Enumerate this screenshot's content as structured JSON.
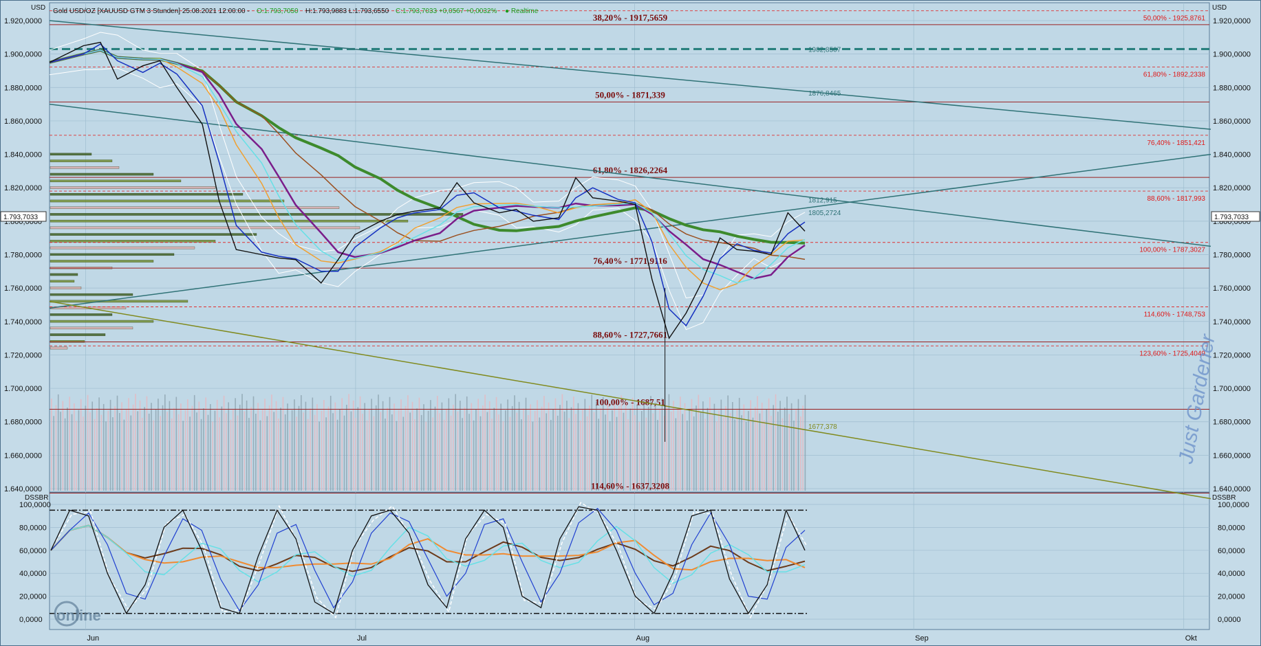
{
  "header": {
    "instrument": "Gold USD/OZ [XAUUSD GTM 3 Stunden] 25.08.2021 12:00:00 -",
    "open": "O:1.793,7050",
    "hl": "H:1.793,9883 L:1.793,6550",
    "close_change": "C:1.793,7033 +0,0567 +0,0032%",
    "realtime": "● Realtime"
  },
  "units": {
    "left": "USD",
    "right": "USD",
    "osc_left": "DSSBR",
    "osc_right": "DSSBR"
  },
  "current_price_label": "1.793,7033",
  "watermark": "Just Gardener",
  "logo_text": "online",
  "colors": {
    "background": "#c5dbe8",
    "fib_dashed": "#e03030",
    "fib_solid": "#9a2020",
    "teal_line": "#2f7276",
    "olive_line": "#808a1e",
    "green_ma": "#3d8a2c",
    "purple_ma": "#7a1d8a",
    "brown_ma": "#9a5020",
    "orange_ma": "#f0a030",
    "cyan_ma": "#66e0e6",
    "blue_ma": "#1530c0",
    "price": "#111111"
  },
  "chart_data": [
    {
      "type": "line",
      "title": "",
      "xlabel": "",
      "ylabel": "USD",
      "ylim": [
        1630,
        1930
      ],
      "grid": true,
      "x_ticks": [
        "Jun",
        "Jul",
        "Aug",
        "Sep",
        "Okt"
      ],
      "y_ticks": [
        "1.640,0000",
        "1.660,0000",
        "1.680,0000",
        "1.700,0000",
        "1.720,0000",
        "1.740,0000",
        "1.760,0000",
        "1.780,0000",
        "1.800,0000",
        "1.820,0000",
        "1.840,0000",
        "1.860,0000",
        "1.880,0000",
        "1.900,0000",
        "1.920,0000"
      ],
      "y_tick_values": [
        1640,
        1660,
        1680,
        1700,
        1720,
        1740,
        1760,
        1780,
        1800,
        1820,
        1840,
        1860,
        1880,
        1900,
        1920
      ],
      "price_series": {
        "x": [
          "2021-05-28",
          "2021-06-01",
          "2021-06-03",
          "2021-06-05",
          "2021-06-08",
          "2021-06-10",
          "2021-06-12",
          "2021-06-15",
          "2021-06-17",
          "2021-06-19",
          "2021-06-22",
          "2021-06-24",
          "2021-06-26",
          "2021-06-29",
          "2021-07-01",
          "2021-07-03",
          "2021-07-06",
          "2021-07-08",
          "2021-07-10",
          "2021-07-13",
          "2021-07-15",
          "2021-07-17",
          "2021-07-20",
          "2021-07-22",
          "2021-07-24",
          "2021-07-27",
          "2021-07-29",
          "2021-07-31",
          "2021-08-03",
          "2021-08-05",
          "2021-08-07",
          "2021-08-09",
          "2021-08-11",
          "2021-08-13",
          "2021-08-15",
          "2021-08-17",
          "2021-08-19",
          "2021-08-21",
          "2021-08-23",
          "2021-08-25"
        ],
        "y": [
          1895,
          1905,
          1907,
          1885,
          1893,
          1896,
          1880,
          1858,
          1812,
          1783,
          1780,
          1778,
          1777,
          1763,
          1777,
          1792,
          1800,
          1804,
          1806,
          1808,
          1823,
          1811,
          1805,
          1807,
          1800,
          1802,
          1826,
          1814,
          1812,
          1810,
          1765,
          1730,
          1745,
          1765,
          1790,
          1783,
          1782,
          1780,
          1805,
          1794
        ]
      },
      "fib_levels_right": [
        {
          "label": "50,00% - 1925,8761",
          "value": 1925.8761
        },
        {
          "label": "61,80% - 1892,2338",
          "value": 1892.2338
        },
        {
          "label": "76,40% - 1851,421",
          "value": 1851.421
        },
        {
          "label": "88,60% - 1817,993",
          "value": 1817.993
        },
        {
          "label": "100,00% - 1787,3027",
          "value": 1787.3027
        },
        {
          "label": "114,60% - 1748,753",
          "value": 1748.753
        },
        {
          "label": "123,60% - 1725,4049",
          "value": 1725.4049
        }
      ],
      "fib_levels_center": [
        {
          "label": "38,20% - 1917,5659",
          "value": 1917.5659
        },
        {
          "label": "50,00% - 1871,339",
          "value": 1871.339
        },
        {
          "label": "61,80% - 1826,2264",
          "value": 1826.2264
        },
        {
          "label": "76,40% - 1771,9116",
          "value": 1771.9116
        },
        {
          "label": "88,60% - 1727,7661",
          "value": 1727.7661
        },
        {
          "label": "100,00% - 1687,51",
          "value": 1687.51
        },
        {
          "label": "114,60% - 1637,3208",
          "value": 1637.3208
        }
      ],
      "teal_dashed_level": 1903,
      "trend_labels": [
        {
          "label": "1902,8507",
          "value": 1902.8507
        },
        {
          "label": "1876,8465",
          "value": 1876.8465
        },
        {
          "label": "1812,915",
          "value": 1812.915
        },
        {
          "label": "1805,2724",
          "value": 1805.2724
        },
        {
          "label": "1677,378",
          "value": 1677.378
        }
      ],
      "trendlines": [
        {
          "name": "teal-upper",
          "from": [
            "2021-05-28",
            1920
          ],
          "to": [
            "2021-10-04",
            1855
          ]
        },
        {
          "name": "teal-middle",
          "from": [
            "2021-05-28",
            1870
          ],
          "to": [
            "2021-10-04",
            1785
          ]
        },
        {
          "name": "teal-rising",
          "from": [
            "2021-05-28",
            1748
          ],
          "to": [
            "2021-10-04",
            1840
          ]
        },
        {
          "name": "olive-falling",
          "from": [
            "2021-05-28",
            1752
          ],
          "to": [
            "2021-10-04",
            1634
          ]
        }
      ]
    },
    {
      "type": "line",
      "title": "",
      "ylabel": "DSSBR",
      "ylim": [
        -5,
        105
      ],
      "y_ticks": [
        "0,0000",
        "20,0000",
        "40,0000",
        "60,0000",
        "80,0000",
        "100,0000"
      ],
      "y_tick_values": [
        0,
        20,
        40,
        60,
        80,
        100
      ],
      "band_levels": [
        95,
        5
      ],
      "series_oscillator": [
        60,
        95,
        90,
        40,
        5,
        30,
        80,
        95,
        60,
        10,
        5,
        55,
        95,
        70,
        15,
        5,
        60,
        90,
        95,
        75,
        30,
        10,
        70,
        95,
        80,
        20,
        10,
        70,
        98,
        95,
        60,
        20,
        5,
        40,
        90,
        95,
        35,
        5,
        30,
        95,
        60
      ]
    }
  ]
}
